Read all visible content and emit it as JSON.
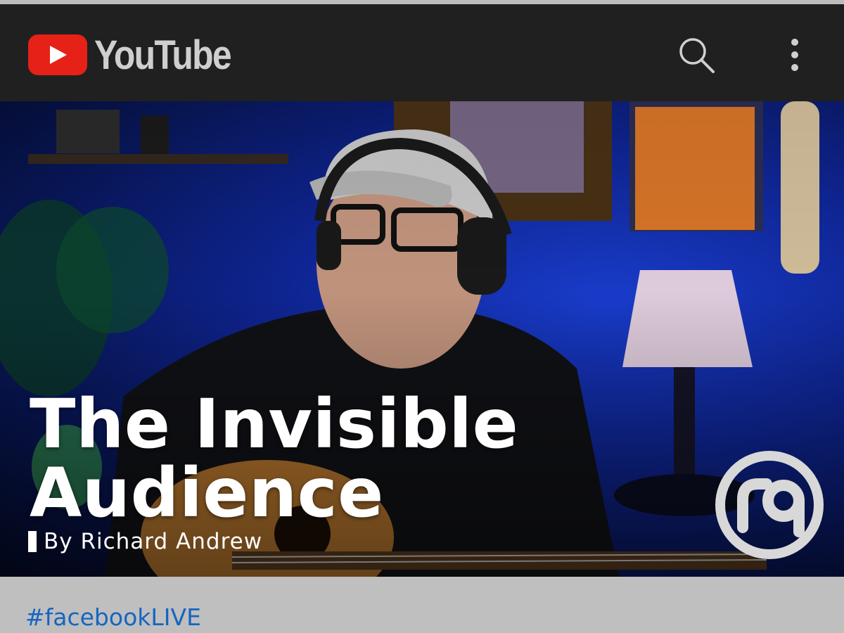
{
  "app": {
    "brand": "YouTube",
    "brand_color": "#e62117"
  },
  "appbar": {
    "icons": [
      "search-icon",
      "more-vert-icon"
    ]
  },
  "video": {
    "title": "The Invisible Audience",
    "byline": "By Richard Andrew",
    "channel_logo": "rq"
  },
  "description": {
    "hashtag": "#facebookLIVE",
    "hashtag_color": "#1565c0"
  }
}
